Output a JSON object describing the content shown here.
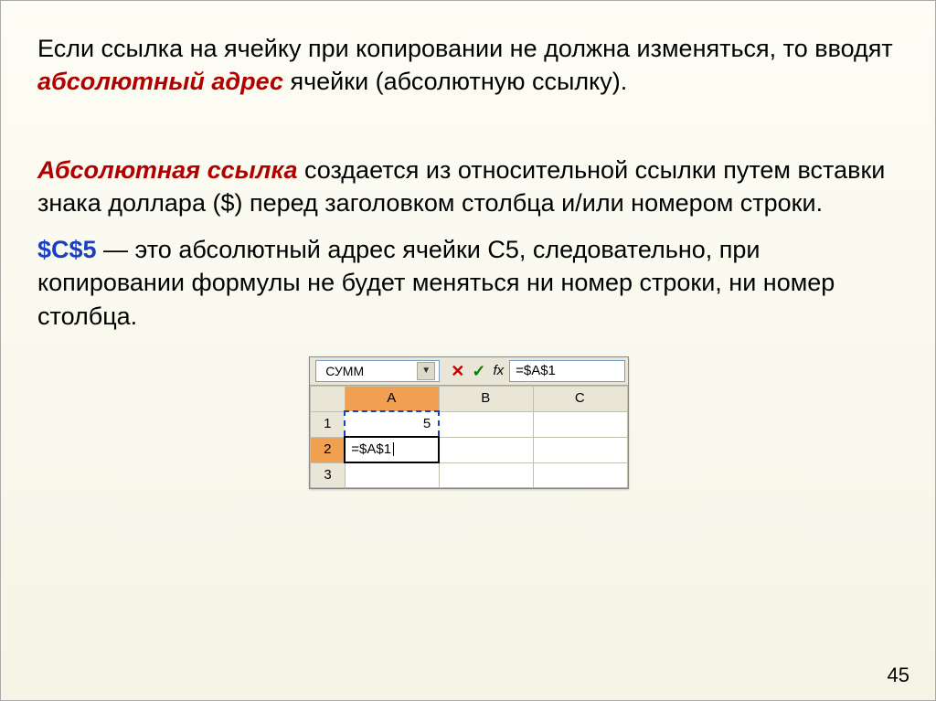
{
  "para1": {
    "t1": "Если ссылка на ячейку при копировании не должна изменяться, то вводят ",
    "em": "абсолютный адрес",
    "t2": " ячейки (абсолютную ссылку)."
  },
  "para2": {
    "em": "Абсолютная ссылка",
    "t1": " создается из относительной ссылки путем вставки знака доллара ($) перед заголовком столбца и/или номером строки."
  },
  "para3": {
    "em": "$C$5",
    "t1": " — это абсолютный адрес ячейки С5, следовательно, при копировании формулы не будет меняться ни номер строки, ни номер столбца."
  },
  "excel": {
    "name_box": "СУММ",
    "formula": "=$A$1",
    "cols": [
      "A",
      "B",
      "C"
    ],
    "rows": [
      "1",
      "2",
      "3"
    ],
    "a1": "5",
    "a2": "=$A$1"
  },
  "page_number": "45"
}
